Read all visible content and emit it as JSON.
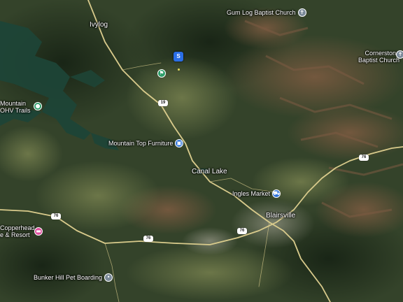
{
  "colors": {
    "terrain_base": "#2f3d25",
    "forest_dark": "#1e2b18",
    "ridge_brown": "#6b4a35",
    "farmland": "#6f7a4a",
    "lake": "#1f4a3a",
    "road": "#d8c98a",
    "park_pin": "#2e9e6a",
    "shop_pin": "#2f74d9",
    "lodging_pin": "#e04e9e",
    "place_pin": "#7b8a9a",
    "church_pin": "#7b8a9a",
    "selection_marker": "#2a6ee6"
  },
  "places": {
    "ivylog": "Ivylog",
    "canal_lake": "Canal Lake",
    "blairsville": "Blairsville",
    "gum_log": "Gum Log Baptist Church",
    "cornerstone_line1": "Cornerstone",
    "cornerstone_line2": "Baptist Church",
    "mountain_ohv_line1": "Mountain",
    "mountain_ohv_line2": "OHV Trails",
    "mountain_top_furniture": "Mountain Top Furniture",
    "ingles_market": "Ingles Market",
    "copperhead_line1": "Copperhead",
    "copperhead_line2": "e & Resort",
    "bunker_hill": "Bunker Hill Pet Boarding"
  },
  "routes": {
    "r19": "19",
    "r76_west": "76",
    "r76_mid1": "76",
    "r76_mid2": "76",
    "r76_east": "76"
  },
  "marker": {
    "letter": "S"
  },
  "icons": {
    "church": "cross-icon",
    "park": "park-icon",
    "shop": "shopping-icon",
    "cart": "shopping-cart-icon",
    "lodging": "bed-icon",
    "place": "location-dot-icon",
    "golf": "golf-icon"
  }
}
